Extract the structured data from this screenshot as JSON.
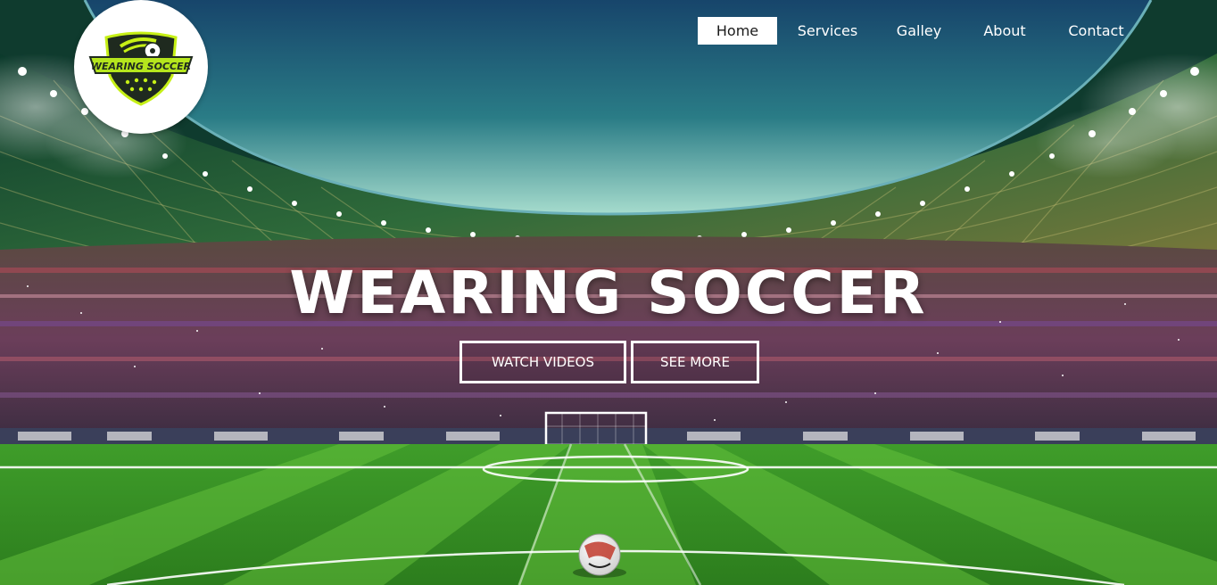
{
  "brand": {
    "logo_text": "WEARING SOCCER",
    "logo_colors": {
      "shield": "#1f2a1f",
      "accent": "#c6f016",
      "band": "#b5e61d"
    }
  },
  "nav": {
    "items": [
      {
        "label": "Home",
        "active": true
      },
      {
        "label": "Services",
        "active": false
      },
      {
        "label": "Galley",
        "active": false
      },
      {
        "label": "About",
        "active": false
      },
      {
        "label": "Contact",
        "active": false
      }
    ]
  },
  "hero": {
    "title": "WEARING SOCCER",
    "buttons": {
      "watch_videos": "WATCH VIDEOS",
      "see_more": "SEE MORE"
    }
  },
  "colors": {
    "sky_top": "#1b4f73",
    "sky_mid": "#2b7f86",
    "sky_light": "#8fd4c8",
    "pitch_light": "#5fbf3a",
    "pitch_dark": "#2f8e22",
    "roof": "#0f3b2e",
    "crowd": "#4a3a55"
  }
}
